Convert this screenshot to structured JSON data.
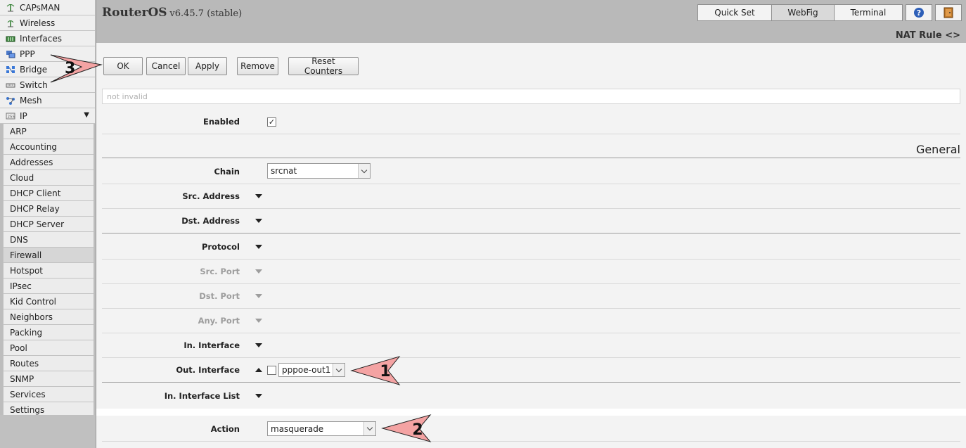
{
  "sidebar": {
    "top_items": [
      {
        "label": "CAPsMAN",
        "icon": "capsman-icon"
      },
      {
        "label": "Wireless",
        "icon": "wireless-icon"
      },
      {
        "label": "Interfaces",
        "icon": "interfaces-icon"
      },
      {
        "label": "PPP",
        "icon": "ppp-icon"
      },
      {
        "label": "Bridge",
        "icon": "bridge-icon"
      },
      {
        "label": "Switch",
        "icon": "switch-icon"
      },
      {
        "label": "Mesh",
        "icon": "mesh-icon"
      },
      {
        "label": "IP",
        "icon": "ip-icon",
        "expanded": true
      }
    ],
    "ip_submenu": [
      "ARP",
      "Accounting",
      "Addresses",
      "Cloud",
      "DHCP Client",
      "DHCP Relay",
      "DHCP Server",
      "DNS",
      "Firewall",
      "Hotspot",
      "IPsec",
      "Kid Control",
      "Neighbors",
      "Packing",
      "Pool",
      "Routes",
      "SNMP",
      "Services",
      "Settings"
    ],
    "active_item": "Firewall"
  },
  "header": {
    "brand": "RouterOS",
    "version": "v6.45.7 (stable)",
    "modes": [
      "Quick Set",
      "WebFig",
      "Terminal"
    ],
    "active_mode": "WebFig",
    "page_title": "NAT Rule <>"
  },
  "toolbar": {
    "ok": "OK",
    "cancel": "Cancel",
    "apply": "Apply",
    "remove": "Remove",
    "reset_counters": "Reset Counters"
  },
  "status_text": "not invalid",
  "form": {
    "enabled_label": "Enabled",
    "enabled_checked": true,
    "section_general": "General",
    "chain_label": "Chain",
    "chain_value": "srcnat",
    "src_address_label": "Src. Address",
    "dst_address_label": "Dst. Address",
    "protocol_label": "Protocol",
    "src_port_label": "Src. Port",
    "dst_port_label": "Dst. Port",
    "any_port_label": "Any. Port",
    "in_interface_label": "In. Interface",
    "out_interface_label": "Out. Interface",
    "out_interface_negate": false,
    "out_interface_value": "pppoe-out1",
    "in_interface_list_label": "In. Interface List",
    "action_label": "Action",
    "action_value": "masquerade"
  },
  "annotations": {
    "callout_1": "1",
    "callout_2": "2",
    "callout_3": "3",
    "callout_color": "#f4a3a3"
  }
}
